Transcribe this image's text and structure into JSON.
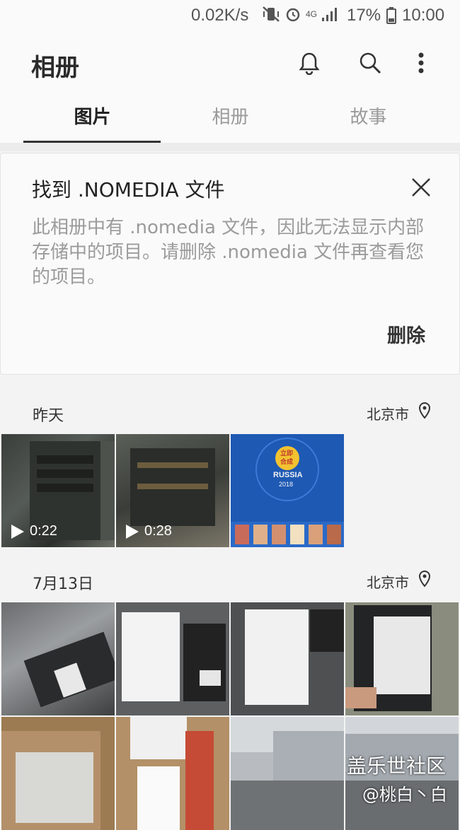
{
  "status_bar": {
    "network_rate": "0.02K/s",
    "network_type": "4G",
    "battery": "17%",
    "time": "10:00"
  },
  "app_bar": {
    "title": "相册",
    "icons": [
      "bell-icon",
      "search-icon",
      "more-vert-icon"
    ]
  },
  "tabs": [
    {
      "label": "图片",
      "active": true
    },
    {
      "label": "相册",
      "active": false
    },
    {
      "label": "故事",
      "active": false
    }
  ],
  "notice": {
    "title": "找到 .NOMEDIA 文件",
    "body": "此相册中有 .nomedia 文件，因此无法显示内部存储中的项目。请删除 .nomedia 文件再查看您的项目。",
    "action": "删除"
  },
  "sections": [
    {
      "date": "昨天",
      "location": "北京市",
      "items": [
        {
          "type": "video",
          "duration": "0:22"
        },
        {
          "type": "video",
          "duration": "0:28"
        },
        {
          "type": "image",
          "caption_lines": [
            "立即",
            "合成",
            "RUSSIA",
            "2018"
          ]
        }
      ]
    },
    {
      "date": "7月13日",
      "location": "北京市",
      "items": [
        {
          "type": "image"
        },
        {
          "type": "image"
        },
        {
          "type": "image"
        },
        {
          "type": "image"
        },
        {
          "type": "image"
        },
        {
          "type": "image"
        },
        {
          "type": "image"
        },
        {
          "type": "image"
        }
      ]
    }
  ],
  "watermark": {
    "line1": "盖乐世社区",
    "line2": "@桃白丶白"
  },
  "colors": {
    "accent": "#222222",
    "muted": "#9b9b9b",
    "background": "#f3f3f3"
  }
}
